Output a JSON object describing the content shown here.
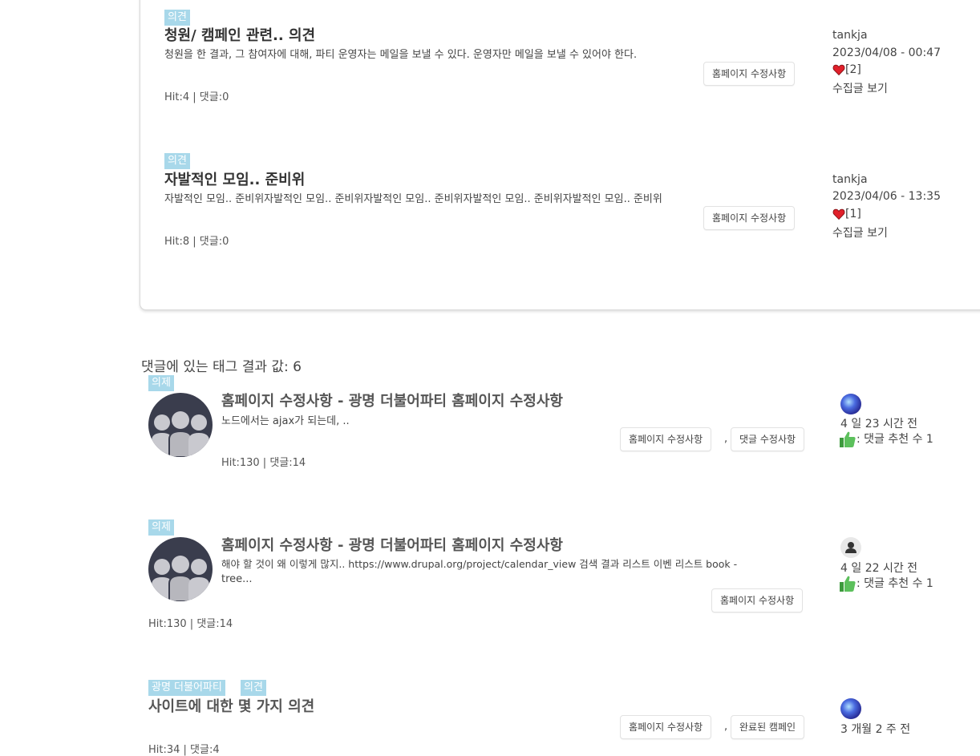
{
  "posts": [
    {
      "tag": "의견",
      "title": "청원/ 캠페인 관련.. 의견",
      "desc": "청원을 한 결과,  그 참여자에 대해,  파티 운영자는 메일을 보낼 수 있다.  운영자만 메일을 보낼 수 있어야 한다.",
      "pill": "홈페이지 수정사항",
      "stats": "Hit:4 | 댓글:0",
      "author": "tankja",
      "date": "2023/04/08 - 00:47",
      "likes": "[2]",
      "collect": "수집글 보기"
    },
    {
      "tag": "의견",
      "title": "자발적인 모임.. 준비위",
      "desc": "자발적인 모임.. 준비위자발적인 모임.. 준비위자발적인 모임.. 준비위자발적인 모임.. 준비위자발적인 모임.. 준비위",
      "pill": "홈페이지 수정사항",
      "stats": "Hit:8 | 댓글:0",
      "author": "tankja",
      "date": "2023/04/06 - 13:35",
      "likes": "[1]",
      "collect": "수집글 보기"
    }
  ],
  "comment_heading": "댓글에 있는 태그 결과 값: 6",
  "comments": [
    {
      "tag": "의제",
      "title": "홈페이지 수정사항 - 광명 더불어파티 홈페이지 수정사항",
      "desc": "노드에서는 ajax가 되는데, ..",
      "pills": [
        "홈페이지 수정사항",
        "댓글 수정사항"
      ],
      "separator": ",",
      "stats": "Hit:130 | 댓글:14",
      "time": "4 일 23 시간 전",
      "recommend": ": 댓글 추천 수 1"
    },
    {
      "tag": "의제",
      "title": "홈페이지 수정사항 - 광명 더불어파티 홈페이지 수정사항",
      "desc_line1": "해야 할 것이 왜 이렇게 많지..   https://www.drupal.org/project/calendar_view 검색 결과 리스트 이벤 리스트 book -",
      "desc_line2": "tree...",
      "pills": [
        "홈페이지 수정사항"
      ],
      "stats": "Hit:130 | 댓글:14",
      "time": "4 일 22 시간 전",
      "recommend": ": 댓글 추천 수 1"
    },
    {
      "tags": [
        "광명 더불어파티",
        "의견"
      ],
      "title": "사이트에 대한 몇 가지 의견",
      "pills": [
        "홈페이지 수정사항",
        "완료된 캠페인"
      ],
      "separator": ",",
      "stats": "Hit:34 | 댓글:4",
      "time": "3 개월 2 주 전"
    }
  ],
  "icons": {
    "heart": "heart-icon",
    "thumb": "thumbs-up-icon",
    "group": "group-avatar-icon",
    "user": "user-avatar-icon"
  },
  "colors": {
    "tag_bg": "#a8d8ea",
    "heart": "#e0202a",
    "thumb": "#4caf50",
    "avatar_bg": "#3a3d4d"
  }
}
